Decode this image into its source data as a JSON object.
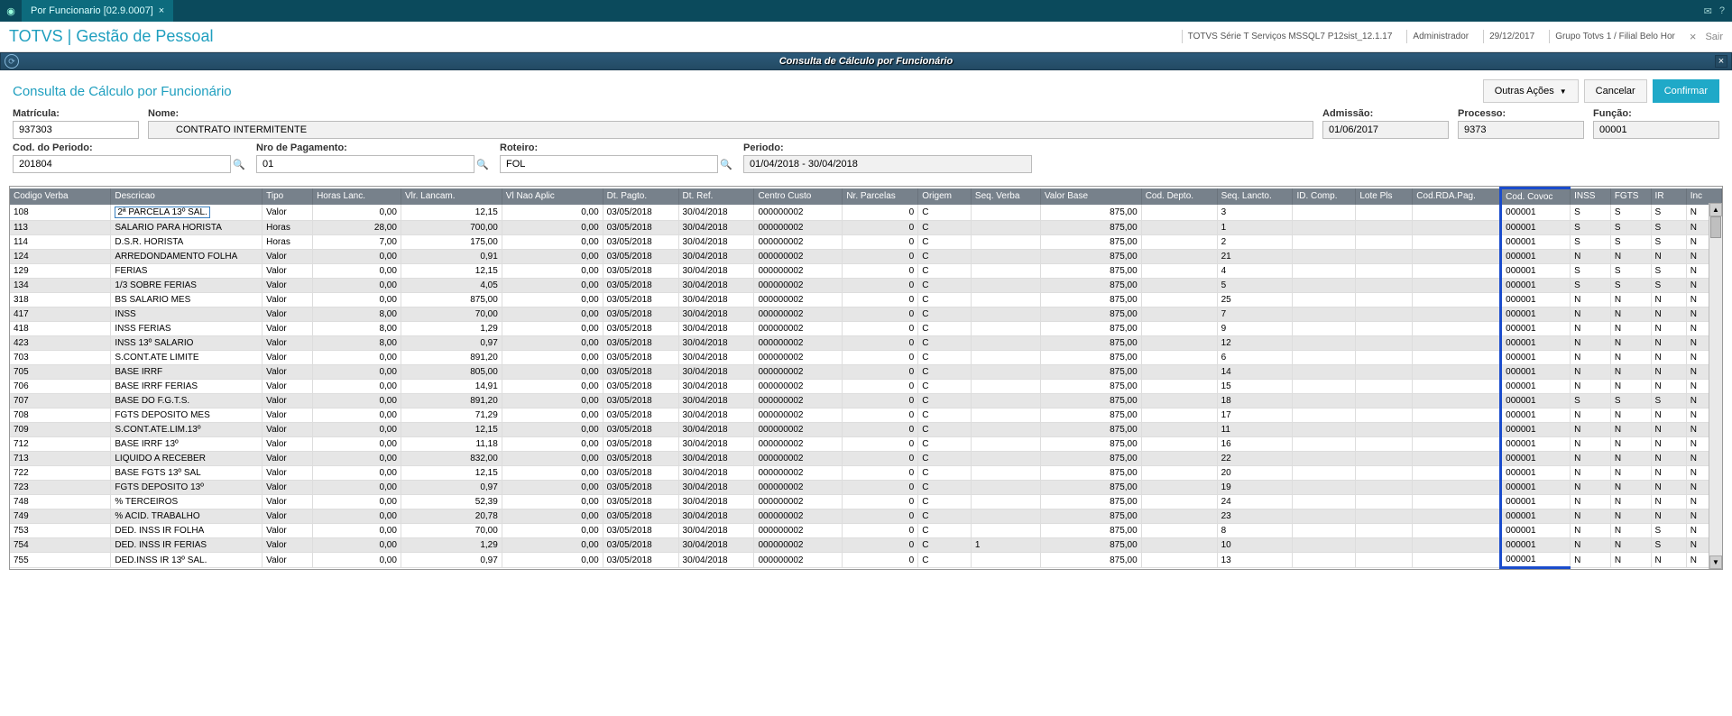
{
  "topbar": {
    "tab_label": "Por Funcionario [02.9.0007]",
    "exit_label": "Sair"
  },
  "header": {
    "brand": "TOTVS | Gestão de Pessoal",
    "env": "TOTVS Série T Serviços MSSQL7 P12sist_12.1.17",
    "user": "Administrador",
    "date": "29/12/2017",
    "group": "Grupo Totvs 1 / Filial Belo Hor"
  },
  "window": {
    "title": "Consulta de Cálculo por Funcionário"
  },
  "toolbar": {
    "page_title": "Consulta de Cálculo por Funcionário",
    "other_actions": "Outras Ações",
    "cancel": "Cancelar",
    "confirm": "Confirmar"
  },
  "form": {
    "matricula_label": "Matrícula:",
    "matricula": "937303",
    "nome_label": "Nome:",
    "nome": "CONTRATO INTERMITENTE",
    "admissao_label": "Admissão:",
    "admissao": "01/06/2017",
    "processo_label": "Processo:",
    "processo": "9373",
    "funcao_label": "Função:",
    "funcao": "00001",
    "cod_periodo_label": "Cod. do Periodo:",
    "cod_periodo": "201804",
    "nro_pag_label": "Nro de Pagamento:",
    "nro_pag": "01",
    "roteiro_label": "Roteiro:",
    "roteiro": "FOL",
    "periodo_label": "Periodo:",
    "periodo": "01/04/2018 - 30/04/2018"
  },
  "grid": {
    "columns": [
      "Codigo Verba",
      "Descricao",
      "Tipo",
      "Horas Lanc.",
      "Vlr. Lancam.",
      "Vl Nao Aplic",
      "Dt. Pagto.",
      "Dt. Ref.",
      "Centro Custo",
      "Nr. Parcelas",
      "Origem",
      "Seq. Verba",
      "Valor Base",
      "Cod. Depto.",
      "Seq. Lancto.",
      "ID. Comp.",
      "Lote Pls",
      "Cod.RDA.Pag.",
      "Cod. Covoc",
      "INSS",
      "FGTS",
      "IR",
      "Inc"
    ],
    "rows": [
      {
        "cod": "108",
        "desc": "2ª PARCELA 13º SAL.",
        "tipo": "Valor",
        "horas": "0,00",
        "vlr": "12,15",
        "vlna": "0,00",
        "dtp": "03/05/2018",
        "dtr": "30/04/2018",
        "cc": "000000002",
        "np": "0",
        "orig": "C",
        "seqv": "",
        "vb": "875,00",
        "cdep": "",
        "seql": "3",
        "idc": "",
        "lote": "",
        "crda": "",
        "covoc": "000001",
        "inss": "S",
        "fgts": "S",
        "ir": "S",
        "inc": "N"
      },
      {
        "cod": "113",
        "desc": "SALARIO PARA HORISTA",
        "tipo": "Horas",
        "horas": "28,00",
        "vlr": "700,00",
        "vlna": "0,00",
        "dtp": "03/05/2018",
        "dtr": "30/04/2018",
        "cc": "000000002",
        "np": "0",
        "orig": "C",
        "seqv": "",
        "vb": "875,00",
        "cdep": "",
        "seql": "1",
        "idc": "",
        "lote": "",
        "crda": "",
        "covoc": "000001",
        "inss": "S",
        "fgts": "S",
        "ir": "S",
        "inc": "N"
      },
      {
        "cod": "114",
        "desc": "D.S.R. HORISTA",
        "tipo": "Horas",
        "horas": "7,00",
        "vlr": "175,00",
        "vlna": "0,00",
        "dtp": "03/05/2018",
        "dtr": "30/04/2018",
        "cc": "000000002",
        "np": "0",
        "orig": "C",
        "seqv": "",
        "vb": "875,00",
        "cdep": "",
        "seql": "2",
        "idc": "",
        "lote": "",
        "crda": "",
        "covoc": "000001",
        "inss": "S",
        "fgts": "S",
        "ir": "S",
        "inc": "N"
      },
      {
        "cod": "124",
        "desc": "ARREDONDAMENTO FOLHA",
        "tipo": "Valor",
        "horas": "0,00",
        "vlr": "0,91",
        "vlna": "0,00",
        "dtp": "03/05/2018",
        "dtr": "30/04/2018",
        "cc": "000000002",
        "np": "0",
        "orig": "C",
        "seqv": "",
        "vb": "875,00",
        "cdep": "",
        "seql": "21",
        "idc": "",
        "lote": "",
        "crda": "",
        "covoc": "000001",
        "inss": "N",
        "fgts": "N",
        "ir": "N",
        "inc": "N"
      },
      {
        "cod": "129",
        "desc": "FERIAS",
        "tipo": "Valor",
        "horas": "0,00",
        "vlr": "12,15",
        "vlna": "0,00",
        "dtp": "03/05/2018",
        "dtr": "30/04/2018",
        "cc": "000000002",
        "np": "0",
        "orig": "C",
        "seqv": "",
        "vb": "875,00",
        "cdep": "",
        "seql": "4",
        "idc": "",
        "lote": "",
        "crda": "",
        "covoc": "000001",
        "inss": "S",
        "fgts": "S",
        "ir": "S",
        "inc": "N"
      },
      {
        "cod": "134",
        "desc": "1/3 SOBRE FERIAS",
        "tipo": "Valor",
        "horas": "0,00",
        "vlr": "4,05",
        "vlna": "0,00",
        "dtp": "03/05/2018",
        "dtr": "30/04/2018",
        "cc": "000000002",
        "np": "0",
        "orig": "C",
        "seqv": "",
        "vb": "875,00",
        "cdep": "",
        "seql": "5",
        "idc": "",
        "lote": "",
        "crda": "",
        "covoc": "000001",
        "inss": "S",
        "fgts": "S",
        "ir": "S",
        "inc": "N"
      },
      {
        "cod": "318",
        "desc": "BS SALARIO MES",
        "tipo": "Valor",
        "horas": "0,00",
        "vlr": "875,00",
        "vlna": "0,00",
        "dtp": "03/05/2018",
        "dtr": "30/04/2018",
        "cc": "000000002",
        "np": "0",
        "orig": "C",
        "seqv": "",
        "vb": "875,00",
        "cdep": "",
        "seql": "25",
        "idc": "",
        "lote": "",
        "crda": "",
        "covoc": "000001",
        "inss": "N",
        "fgts": "N",
        "ir": "N",
        "inc": "N"
      },
      {
        "cod": "417",
        "desc": "INSS",
        "tipo": "Valor",
        "horas": "8,00",
        "vlr": "70,00",
        "vlna": "0,00",
        "dtp": "03/05/2018",
        "dtr": "30/04/2018",
        "cc": "000000002",
        "np": "0",
        "orig": "C",
        "seqv": "",
        "vb": "875,00",
        "cdep": "",
        "seql": "7",
        "idc": "",
        "lote": "",
        "crda": "",
        "covoc": "000001",
        "inss": "N",
        "fgts": "N",
        "ir": "N",
        "inc": "N"
      },
      {
        "cod": "418",
        "desc": "INSS FERIAS",
        "tipo": "Valor",
        "horas": "8,00",
        "vlr": "1,29",
        "vlna": "0,00",
        "dtp": "03/05/2018",
        "dtr": "30/04/2018",
        "cc": "000000002",
        "np": "0",
        "orig": "C",
        "seqv": "",
        "vb": "875,00",
        "cdep": "",
        "seql": "9",
        "idc": "",
        "lote": "",
        "crda": "",
        "covoc": "000001",
        "inss": "N",
        "fgts": "N",
        "ir": "N",
        "inc": "N"
      },
      {
        "cod": "423",
        "desc": "INSS 13º SALARIO",
        "tipo": "Valor",
        "horas": "8,00",
        "vlr": "0,97",
        "vlna": "0,00",
        "dtp": "03/05/2018",
        "dtr": "30/04/2018",
        "cc": "000000002",
        "np": "0",
        "orig": "C",
        "seqv": "",
        "vb": "875,00",
        "cdep": "",
        "seql": "12",
        "idc": "",
        "lote": "",
        "crda": "",
        "covoc": "000001",
        "inss": "N",
        "fgts": "N",
        "ir": "N",
        "inc": "N"
      },
      {
        "cod": "703",
        "desc": "S.CONT.ATE LIMITE",
        "tipo": "Valor",
        "horas": "0,00",
        "vlr": "891,20",
        "vlna": "0,00",
        "dtp": "03/05/2018",
        "dtr": "30/04/2018",
        "cc": "000000002",
        "np": "0",
        "orig": "C",
        "seqv": "",
        "vb": "875,00",
        "cdep": "",
        "seql": "6",
        "idc": "",
        "lote": "",
        "crda": "",
        "covoc": "000001",
        "inss": "N",
        "fgts": "N",
        "ir": "N",
        "inc": "N"
      },
      {
        "cod": "705",
        "desc": "BASE IRRF",
        "tipo": "Valor",
        "horas": "0,00",
        "vlr": "805,00",
        "vlna": "0,00",
        "dtp": "03/05/2018",
        "dtr": "30/04/2018",
        "cc": "000000002",
        "np": "0",
        "orig": "C",
        "seqv": "",
        "vb": "875,00",
        "cdep": "",
        "seql": "14",
        "idc": "",
        "lote": "",
        "crda": "",
        "covoc": "000001",
        "inss": "N",
        "fgts": "N",
        "ir": "N",
        "inc": "N"
      },
      {
        "cod": "706",
        "desc": "BASE IRRF FERIAS",
        "tipo": "Valor",
        "horas": "0,00",
        "vlr": "14,91",
        "vlna": "0,00",
        "dtp": "03/05/2018",
        "dtr": "30/04/2018",
        "cc": "000000002",
        "np": "0",
        "orig": "C",
        "seqv": "",
        "vb": "875,00",
        "cdep": "",
        "seql": "15",
        "idc": "",
        "lote": "",
        "crda": "",
        "covoc": "000001",
        "inss": "N",
        "fgts": "N",
        "ir": "N",
        "inc": "N"
      },
      {
        "cod": "707",
        "desc": "BASE DO F.G.T.S.",
        "tipo": "Valor",
        "horas": "0,00",
        "vlr": "891,20",
        "vlna": "0,00",
        "dtp": "03/05/2018",
        "dtr": "30/04/2018",
        "cc": "000000002",
        "np": "0",
        "orig": "C",
        "seqv": "",
        "vb": "875,00",
        "cdep": "",
        "seql": "18",
        "idc": "",
        "lote": "",
        "crda": "",
        "covoc": "000001",
        "inss": "S",
        "fgts": "S",
        "ir": "S",
        "inc": "N"
      },
      {
        "cod": "708",
        "desc": "FGTS DEPOSITO MES",
        "tipo": "Valor",
        "horas": "0,00",
        "vlr": "71,29",
        "vlna": "0,00",
        "dtp": "03/05/2018",
        "dtr": "30/04/2018",
        "cc": "000000002",
        "np": "0",
        "orig": "C",
        "seqv": "",
        "vb": "875,00",
        "cdep": "",
        "seql": "17",
        "idc": "",
        "lote": "",
        "crda": "",
        "covoc": "000001",
        "inss": "N",
        "fgts": "N",
        "ir": "N",
        "inc": "N"
      },
      {
        "cod": "709",
        "desc": "S.CONT.ATE.LIM.13º",
        "tipo": "Valor",
        "horas": "0,00",
        "vlr": "12,15",
        "vlna": "0,00",
        "dtp": "03/05/2018",
        "dtr": "30/04/2018",
        "cc": "000000002",
        "np": "0",
        "orig": "C",
        "seqv": "",
        "vb": "875,00",
        "cdep": "",
        "seql": "11",
        "idc": "",
        "lote": "",
        "crda": "",
        "covoc": "000001",
        "inss": "N",
        "fgts": "N",
        "ir": "N",
        "inc": "N"
      },
      {
        "cod": "712",
        "desc": "BASE IRRF 13º",
        "tipo": "Valor",
        "horas": "0,00",
        "vlr": "11,18",
        "vlna": "0,00",
        "dtp": "03/05/2018",
        "dtr": "30/04/2018",
        "cc": "000000002",
        "np": "0",
        "orig": "C",
        "seqv": "",
        "vb": "875,00",
        "cdep": "",
        "seql": "16",
        "idc": "",
        "lote": "",
        "crda": "",
        "covoc": "000001",
        "inss": "N",
        "fgts": "N",
        "ir": "N",
        "inc": "N"
      },
      {
        "cod": "713",
        "desc": "LIQUIDO A RECEBER",
        "tipo": "Valor",
        "horas": "0,00",
        "vlr": "832,00",
        "vlna": "0,00",
        "dtp": "03/05/2018",
        "dtr": "30/04/2018",
        "cc": "000000002",
        "np": "0",
        "orig": "C",
        "seqv": "",
        "vb": "875,00",
        "cdep": "",
        "seql": "22",
        "idc": "",
        "lote": "",
        "crda": "",
        "covoc": "000001",
        "inss": "N",
        "fgts": "N",
        "ir": "N",
        "inc": "N"
      },
      {
        "cod": "722",
        "desc": "BASE FGTS 13º SAL",
        "tipo": "Valor",
        "horas": "0,00",
        "vlr": "12,15",
        "vlna": "0,00",
        "dtp": "03/05/2018",
        "dtr": "30/04/2018",
        "cc": "000000002",
        "np": "0",
        "orig": "C",
        "seqv": "",
        "vb": "875,00",
        "cdep": "",
        "seql": "20",
        "idc": "",
        "lote": "",
        "crda": "",
        "covoc": "000001",
        "inss": "N",
        "fgts": "N",
        "ir": "N",
        "inc": "N"
      },
      {
        "cod": "723",
        "desc": "FGTS DEPOSITO 13º",
        "tipo": "Valor",
        "horas": "0,00",
        "vlr": "0,97",
        "vlna": "0,00",
        "dtp": "03/05/2018",
        "dtr": "30/04/2018",
        "cc": "000000002",
        "np": "0",
        "orig": "C",
        "seqv": "",
        "vb": "875,00",
        "cdep": "",
        "seql": "19",
        "idc": "",
        "lote": "",
        "crda": "",
        "covoc": "000001",
        "inss": "N",
        "fgts": "N",
        "ir": "N",
        "inc": "N"
      },
      {
        "cod": "748",
        "desc": "% TERCEIROS",
        "tipo": "Valor",
        "horas": "0,00",
        "vlr": "52,39",
        "vlna": "0,00",
        "dtp": "03/05/2018",
        "dtr": "30/04/2018",
        "cc": "000000002",
        "np": "0",
        "orig": "C",
        "seqv": "",
        "vb": "875,00",
        "cdep": "",
        "seql": "24",
        "idc": "",
        "lote": "",
        "crda": "",
        "covoc": "000001",
        "inss": "N",
        "fgts": "N",
        "ir": "N",
        "inc": "N"
      },
      {
        "cod": "749",
        "desc": "% ACID. TRABALHO",
        "tipo": "Valor",
        "horas": "0,00",
        "vlr": "20,78",
        "vlna": "0,00",
        "dtp": "03/05/2018",
        "dtr": "30/04/2018",
        "cc": "000000002",
        "np": "0",
        "orig": "C",
        "seqv": "",
        "vb": "875,00",
        "cdep": "",
        "seql": "23",
        "idc": "",
        "lote": "",
        "crda": "",
        "covoc": "000001",
        "inss": "N",
        "fgts": "N",
        "ir": "N",
        "inc": "N"
      },
      {
        "cod": "753",
        "desc": "DED. INSS IR FOLHA",
        "tipo": "Valor",
        "horas": "0,00",
        "vlr": "70,00",
        "vlna": "0,00",
        "dtp": "03/05/2018",
        "dtr": "30/04/2018",
        "cc": "000000002",
        "np": "0",
        "orig": "C",
        "seqv": "",
        "vb": "875,00",
        "cdep": "",
        "seql": "8",
        "idc": "",
        "lote": "",
        "crda": "",
        "covoc": "000001",
        "inss": "N",
        "fgts": "N",
        "ir": "S",
        "inc": "N"
      },
      {
        "cod": "754",
        "desc": "DED. INSS IR FERIAS",
        "tipo": "Valor",
        "horas": "0,00",
        "vlr": "1,29",
        "vlna": "0,00",
        "dtp": "03/05/2018",
        "dtr": "30/04/2018",
        "cc": "000000002",
        "np": "0",
        "orig": "C",
        "seqv": "1",
        "vb": "875,00",
        "cdep": "",
        "seql": "10",
        "idc": "",
        "lote": "",
        "crda": "",
        "covoc": "000001",
        "inss": "N",
        "fgts": "N",
        "ir": "S",
        "inc": "N"
      },
      {
        "cod": "755",
        "desc": "DED.INSS IR 13º SAL.",
        "tipo": "Valor",
        "horas": "0,00",
        "vlr": "0,97",
        "vlna": "0,00",
        "dtp": "03/05/2018",
        "dtr": "30/04/2018",
        "cc": "000000002",
        "np": "0",
        "orig": "C",
        "seqv": "",
        "vb": "875,00",
        "cdep": "",
        "seql": "13",
        "idc": "",
        "lote": "",
        "crda": "",
        "covoc": "000001",
        "inss": "N",
        "fgts": "N",
        "ir": "N",
        "inc": "N"
      }
    ]
  }
}
